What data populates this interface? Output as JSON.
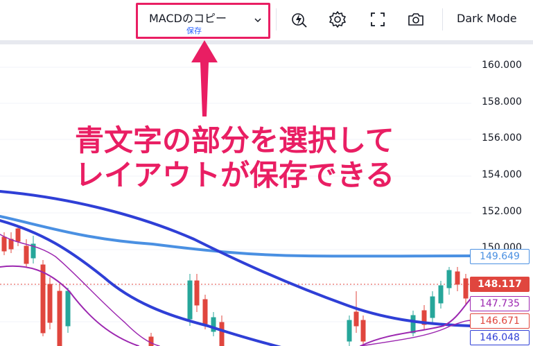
{
  "toolbar": {
    "layout_name": "MACDのコピー",
    "layout_save": "保存",
    "dark_mode_label": "Dark Mode",
    "icons": [
      "alert-lightning-icon",
      "gear-icon",
      "fullscreen-icon",
      "camera-icon"
    ]
  },
  "price_axis": {
    "labels": [
      "160.000",
      "158.000",
      "156.000",
      "154.000",
      "152.000",
      "150.000"
    ]
  },
  "price_tags": [
    {
      "value": "149.649",
      "color": "#4a90e2",
      "style": "outline"
    },
    {
      "value": "148.117",
      "color": "#e0463e",
      "style": "filled"
    },
    {
      "value": "147.735",
      "color": "#9c27b0",
      "style": "outline"
    },
    {
      "value": "146.671",
      "color": "#e0463e",
      "style": "outline"
    },
    {
      "value": "146.048",
      "color": "#2f3fd6",
      "style": "outline"
    }
  ],
  "annotation": {
    "line1": "青文字の部分を選択して",
    "line2": "レイアウトが保存できる",
    "color": "#e91e63"
  },
  "colors": {
    "accent_blue": "#2962ff",
    "highlight_pink": "#e91e63",
    "candle_up": "#26a69a",
    "candle_down": "#ef5350"
  }
}
